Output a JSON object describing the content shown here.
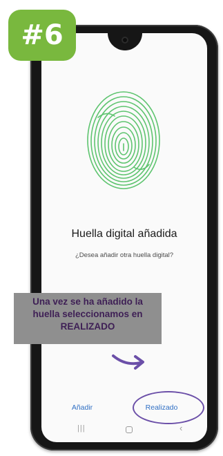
{
  "step_badge": "#6",
  "screen": {
    "title": "Huella digital añadida",
    "subtitle": "¿Desea añadir otra huella digital?",
    "buttons": {
      "add": "Añadir",
      "done": "Realizado"
    },
    "nav_icons": [
      "recent-apps-icon",
      "home-icon",
      "back-icon"
    ]
  },
  "annotation": {
    "lines": [
      "Una vez se ha añadido la",
      "huella seleccionamos en",
      "REALIZADO"
    ]
  },
  "colors": {
    "badge": "#79b83e",
    "fingerprint": "#5ec46f",
    "button_text": "#2f6fc4",
    "annotation_text": "#3e1f55",
    "annotation_bg": "#8f8f8f",
    "highlight": "#6b4fa8"
  }
}
